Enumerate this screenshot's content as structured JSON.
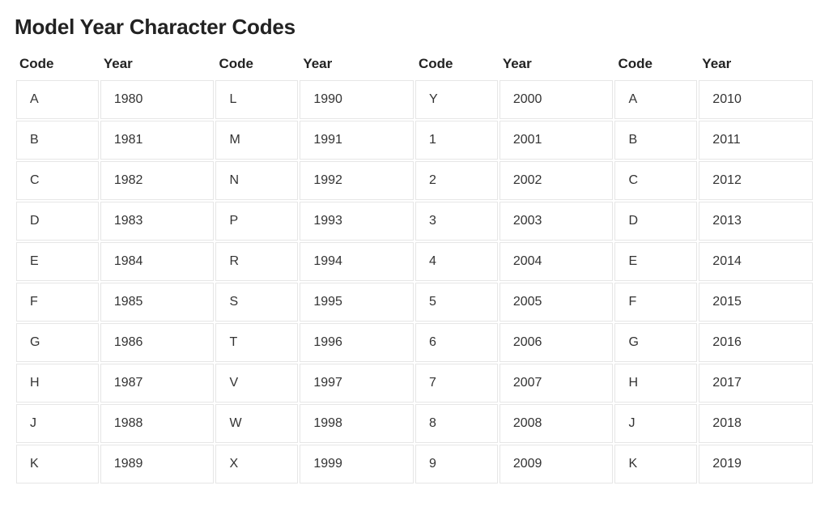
{
  "title": "Model Year Character Codes",
  "headers": {
    "code": "Code",
    "year": "Year"
  },
  "columns": [
    [
      {
        "code": "A",
        "year": "1980"
      },
      {
        "code": "B",
        "year": "1981"
      },
      {
        "code": "C",
        "year": "1982"
      },
      {
        "code": "D",
        "year": "1983"
      },
      {
        "code": "E",
        "year": "1984"
      },
      {
        "code": "F",
        "year": "1985"
      },
      {
        "code": "G",
        "year": "1986"
      },
      {
        "code": "H",
        "year": "1987"
      },
      {
        "code": "J",
        "year": "1988"
      },
      {
        "code": "K",
        "year": "1989"
      }
    ],
    [
      {
        "code": "L",
        "year": "1990"
      },
      {
        "code": "M",
        "year": "1991"
      },
      {
        "code": "N",
        "year": "1992"
      },
      {
        "code": "P",
        "year": "1993"
      },
      {
        "code": "R",
        "year": "1994"
      },
      {
        "code": "S",
        "year": "1995"
      },
      {
        "code": "T",
        "year": "1996"
      },
      {
        "code": "V",
        "year": "1997"
      },
      {
        "code": "W",
        "year": "1998"
      },
      {
        "code": "X",
        "year": "1999"
      }
    ],
    [
      {
        "code": "Y",
        "year": "2000"
      },
      {
        "code": "1",
        "year": "2001"
      },
      {
        "code": "2",
        "year": "2002"
      },
      {
        "code": "3",
        "year": "2003"
      },
      {
        "code": "4",
        "year": "2004"
      },
      {
        "code": "5",
        "year": "2005"
      },
      {
        "code": "6",
        "year": "2006"
      },
      {
        "code": "7",
        "year": "2007"
      },
      {
        "code": "8",
        "year": "2008"
      },
      {
        "code": "9",
        "year": "2009"
      }
    ],
    [
      {
        "code": "A",
        "year": "2010"
      },
      {
        "code": "B",
        "year": "2011"
      },
      {
        "code": "C",
        "year": "2012"
      },
      {
        "code": "D",
        "year": "2013"
      },
      {
        "code": "E",
        "year": "2014"
      },
      {
        "code": "F",
        "year": "2015"
      },
      {
        "code": "G",
        "year": "2016"
      },
      {
        "code": "H",
        "year": "2017"
      },
      {
        "code": "J",
        "year": "2018"
      },
      {
        "code": "K",
        "year": "2019"
      }
    ]
  ]
}
